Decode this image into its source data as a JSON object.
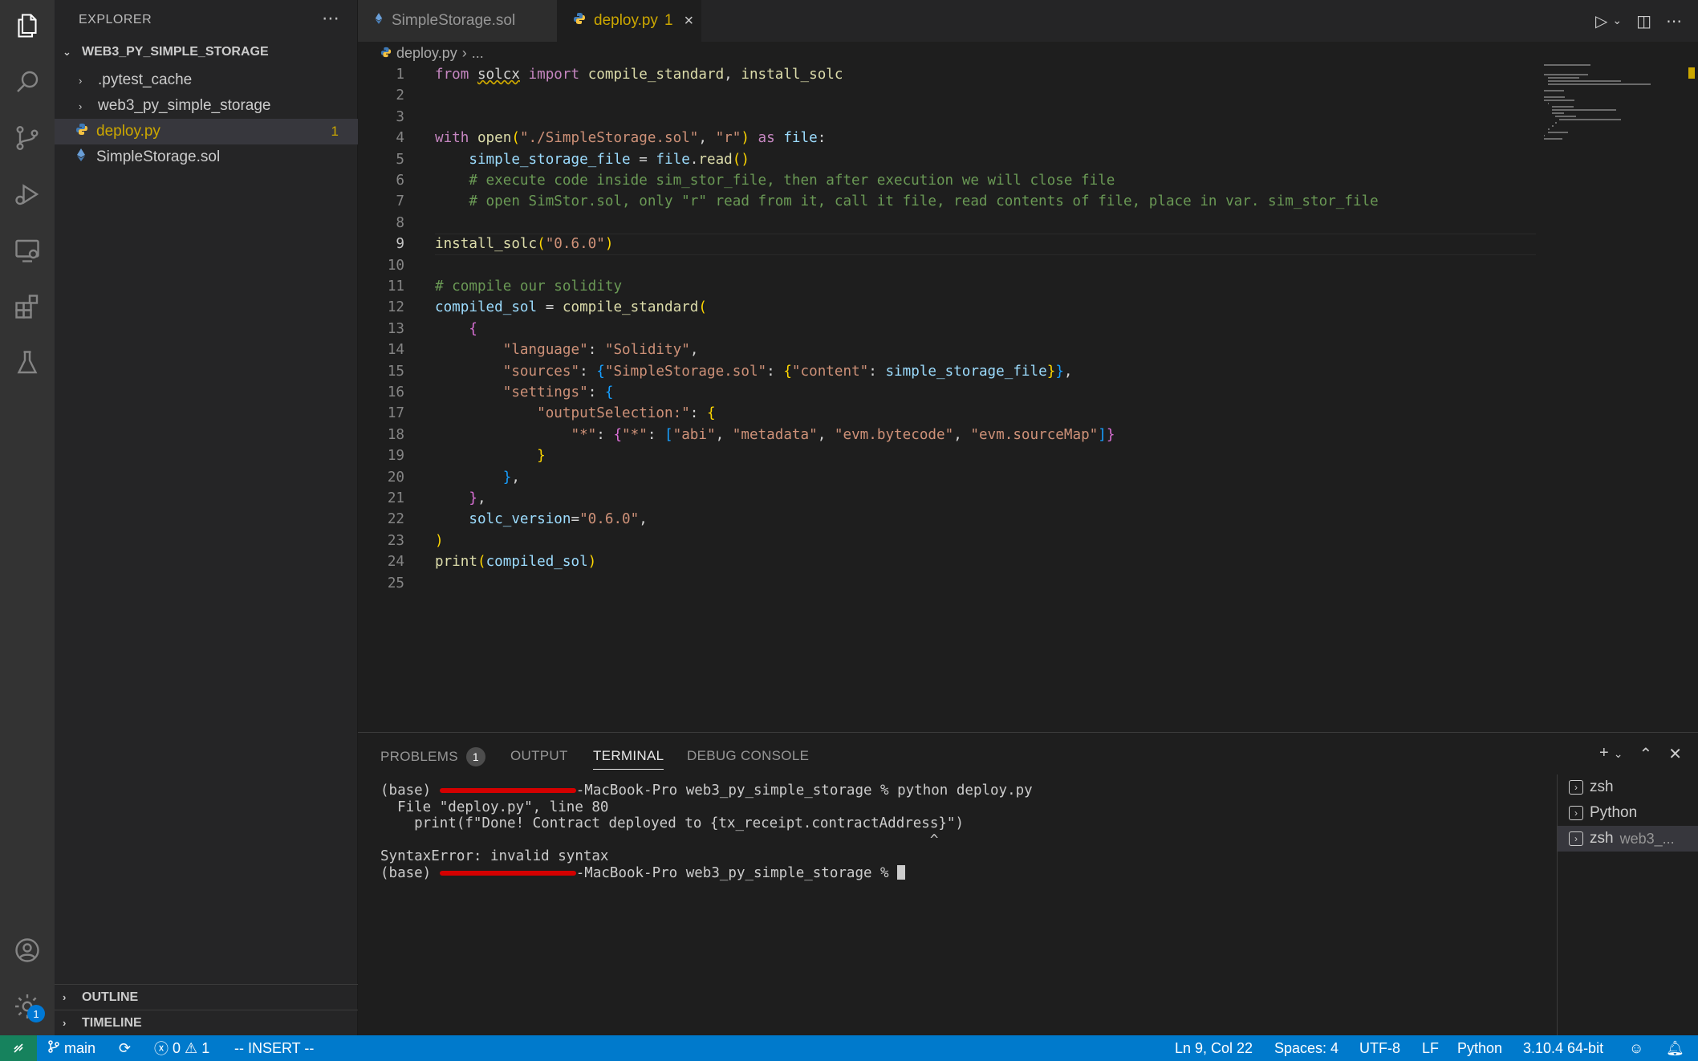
{
  "sidebar": {
    "title": "EXPLORER",
    "project": "WEB3_PY_SIMPLE_STORAGE",
    "items": [
      {
        "label": ".pytest_cache"
      },
      {
        "label": "web3_py_simple_storage"
      },
      {
        "label": "deploy.py",
        "count": "1"
      },
      {
        "label": "SimpleStorage.sol"
      }
    ],
    "outline": "OUTLINE",
    "timeline": "TIMELINE",
    "settings_badge": "1"
  },
  "tabs": [
    {
      "label": "SimpleStorage.sol"
    },
    {
      "label": "deploy.py",
      "count": "1",
      "close": "×"
    }
  ],
  "breadcrumb": {
    "file": "deploy.py",
    "sep": "›",
    "rest": "..."
  },
  "editor": {
    "current_line": 9,
    "lines": [
      "from solcx import compile_standard, install_solc",
      "",
      "",
      "with open(\"./SimpleStorage.sol\", \"r\") as file:",
      "    simple_storage_file = file.read()",
      "    # execute code inside sim_stor_file, then after execution we will close file",
      "    # open SimStor.sol, only \"r\" read from it, call it file, read contents of file, place in var. sim_stor_file",
      "",
      "install_solc(\"0.6.0\")",
      "",
      "# compile our solidity",
      "compiled_sol = compile_standard(",
      "    {",
      "        \"language\": \"Solidity\",",
      "        \"sources\": {\"SimpleStorage.sol\": {\"content\": simple_storage_file}},",
      "        \"settings\": {",
      "            \"outputSelection:\": {",
      "                \"*\": {\"*\": [\"abi\", \"metadata\", \"evm.bytecode\", \"evm.sourceMap\"]}",
      "            }",
      "        },",
      "    },",
      "    solc_version=\"0.6.0\",",
      ")",
      "print(compiled_sol)",
      ""
    ]
  },
  "panel": {
    "tabs": [
      {
        "label": "PROBLEMS",
        "badge": "1"
      },
      {
        "label": "OUTPUT"
      },
      {
        "label": "TERMINAL"
      },
      {
        "label": "DEBUG CONSOLE"
      }
    ],
    "terminal_lines": [
      {
        "pre": "(base) ",
        "post": "-MacBook-Pro web3_py_simple_storage % python deploy.py",
        "redacted": true
      },
      {
        "text": "  File \"deploy.py\", line 80"
      },
      {
        "text": "    print(f\"Done! Contract deployed to {tx_receipt.contractAddress}\")"
      },
      {
        "text": "                                                                 ^"
      },
      {
        "text": "SyntaxError: invalid syntax"
      },
      {
        "pre": "(base) ",
        "post": "-MacBook-Pro web3_py_simple_storage % ",
        "redacted": true,
        "cursor": true
      }
    ],
    "terminals": [
      {
        "label": "zsh"
      },
      {
        "label": "Python"
      },
      {
        "label": "zsh",
        "sub": "web3_..."
      }
    ]
  },
  "status": {
    "branch": "main",
    "errors": "0",
    "warnings": "1",
    "mode": "-- INSERT --",
    "position": "Ln 9, Col 22",
    "spaces": "Spaces: 4",
    "encoding": "UTF-8",
    "eol": "LF",
    "language": "Python",
    "interpreter": "3.10.4 64-bit"
  }
}
